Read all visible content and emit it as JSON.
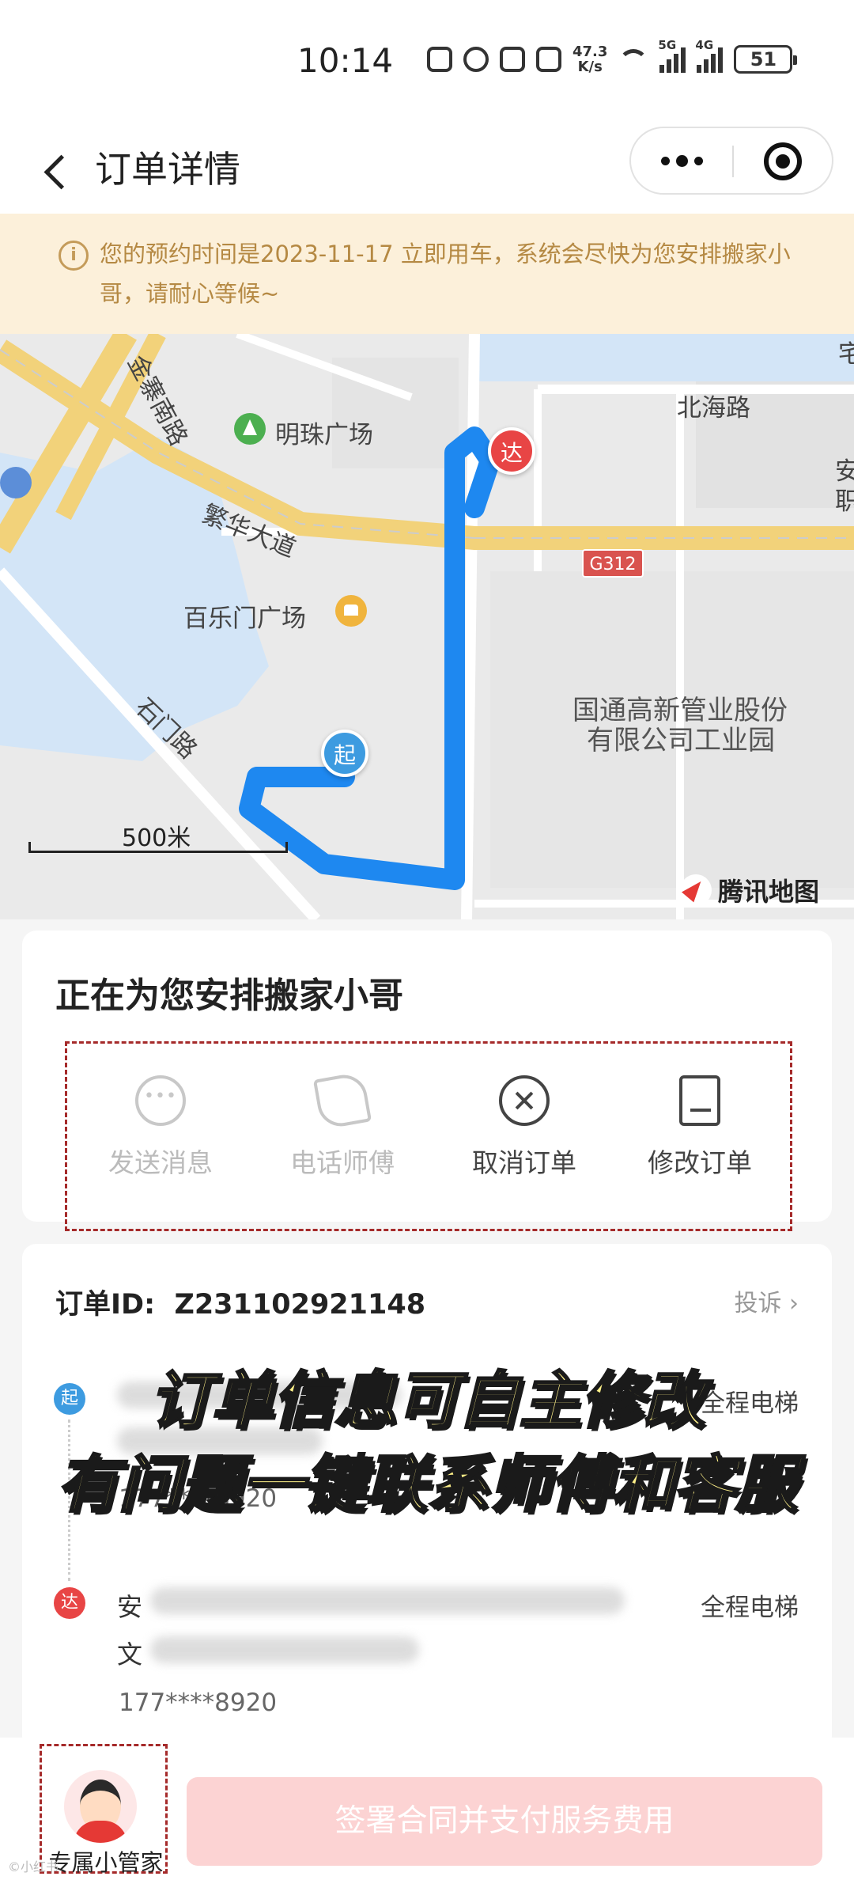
{
  "status_bar": {
    "time": "10:14",
    "net_speed_value": "47.3",
    "net_speed_unit": "K/s",
    "signal_1": "5G",
    "signal_2": "4G",
    "battery": "51"
  },
  "header": {
    "title": "订单详情",
    "icons": [
      "back-icon",
      "more-icon",
      "close-icon"
    ]
  },
  "notice": {
    "icon": "info-icon",
    "text": "您的预约时间是2023-11-17 立即用车，系统会尽快为您安排搬家小哥，请耐心等候~"
  },
  "map": {
    "labels": {
      "road_jinzhai": "金寨南路",
      "road_beihai": "北海路",
      "poi_mingzhu": "明珠广场",
      "road_fanhua": "繁华大道",
      "poi_bailemen": "百乐门广场",
      "road_shimen": "石门路",
      "company_line1": "国通高新管业股份",
      "company_line2": "有限公司工业园",
      "edge_1": "安",
      "edge_2": "职",
      "edge_3": "宅",
      "highway": "G312"
    },
    "start_marker": "起",
    "end_marker": "达",
    "scale": "500米",
    "brand": "腾讯地图",
    "route_color": "#1e88f0"
  },
  "status_card": {
    "title": "正在为您安排搬家小哥",
    "actions": [
      {
        "label": "发送消息",
        "icon": "message-icon",
        "enabled": false
      },
      {
        "label": "电话师傅",
        "icon": "phone-icon",
        "enabled": false
      },
      {
        "label": "取消订单",
        "icon": "cancel-icon",
        "enabled": true
      },
      {
        "label": "修改订单",
        "icon": "edit-icon",
        "enabled": true
      }
    ]
  },
  "order": {
    "id_label": "订单ID:",
    "id_value": "Z231102921148",
    "complain": "投诉 ›",
    "start": {
      "tag": "起",
      "prefix": "",
      "phone": "177****8920",
      "elevator": "全程电梯"
    },
    "end": {
      "tag": "达",
      "prefix": "安",
      "prefix2": "文",
      "phone": "177****8920",
      "elevator": "全程电梯"
    }
  },
  "caption": {
    "line1": "订单信息可自主修改",
    "line2": "有问题一键联系师傅和客服"
  },
  "bottom": {
    "butler_label": "专属小管家",
    "pay_button": "签署合同并支付服务费用",
    "watermark": "©小红书"
  },
  "colors": {
    "accent_red": "#e84545",
    "accent_blue": "#3d9be0",
    "notice_bg": "#fcf0da",
    "notice_text": "#b58943",
    "pay_button_bg": "#fcd3d3"
  }
}
